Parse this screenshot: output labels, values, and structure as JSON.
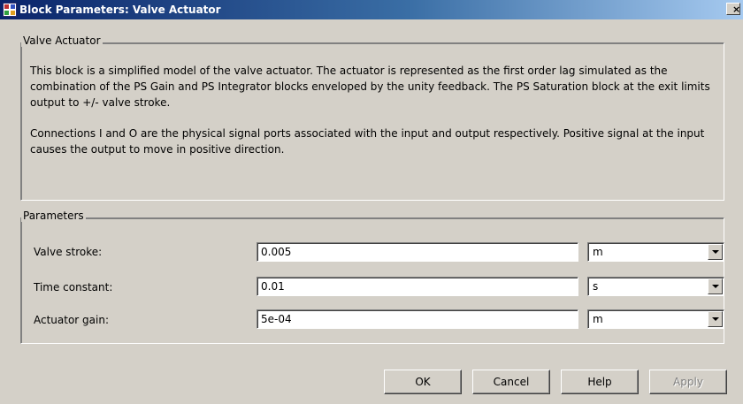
{
  "window": {
    "title": "Block Parameters: Valve Actuator",
    "close_label": "×",
    "icon": "simulink-block-icon"
  },
  "description_group": {
    "legend": "Valve Actuator",
    "paragraph_1": "This block is a simplified model of the valve actuator. The actuator is represented as the first order lag simulated as the combination of the PS Gain and PS Integrator blocks enveloped by the unity feedback. The PS Saturation block at the exit limits output to +/- valve stroke.",
    "paragraph_2": "Connections I and O are the physical signal ports associated with the input and output respectively. Positive signal at the input causes the output to move in positive direction."
  },
  "parameters_group": {
    "legend": "Parameters",
    "rows": [
      {
        "label": "Valve stroke:",
        "value": "0.005",
        "unit": "m"
      },
      {
        "label": "Time constant:",
        "value": "0.01",
        "unit": "s"
      },
      {
        "label": "Actuator gain:",
        "value": "5e-04",
        "unit": "m"
      }
    ]
  },
  "buttons": {
    "ok": "OK",
    "cancel": "Cancel",
    "help": "Help",
    "apply": "Apply"
  },
  "colors": {
    "title_gradient_start": "#0a246a",
    "title_gradient_end": "#a6caf0",
    "window_bg": "#d4d0c8"
  }
}
